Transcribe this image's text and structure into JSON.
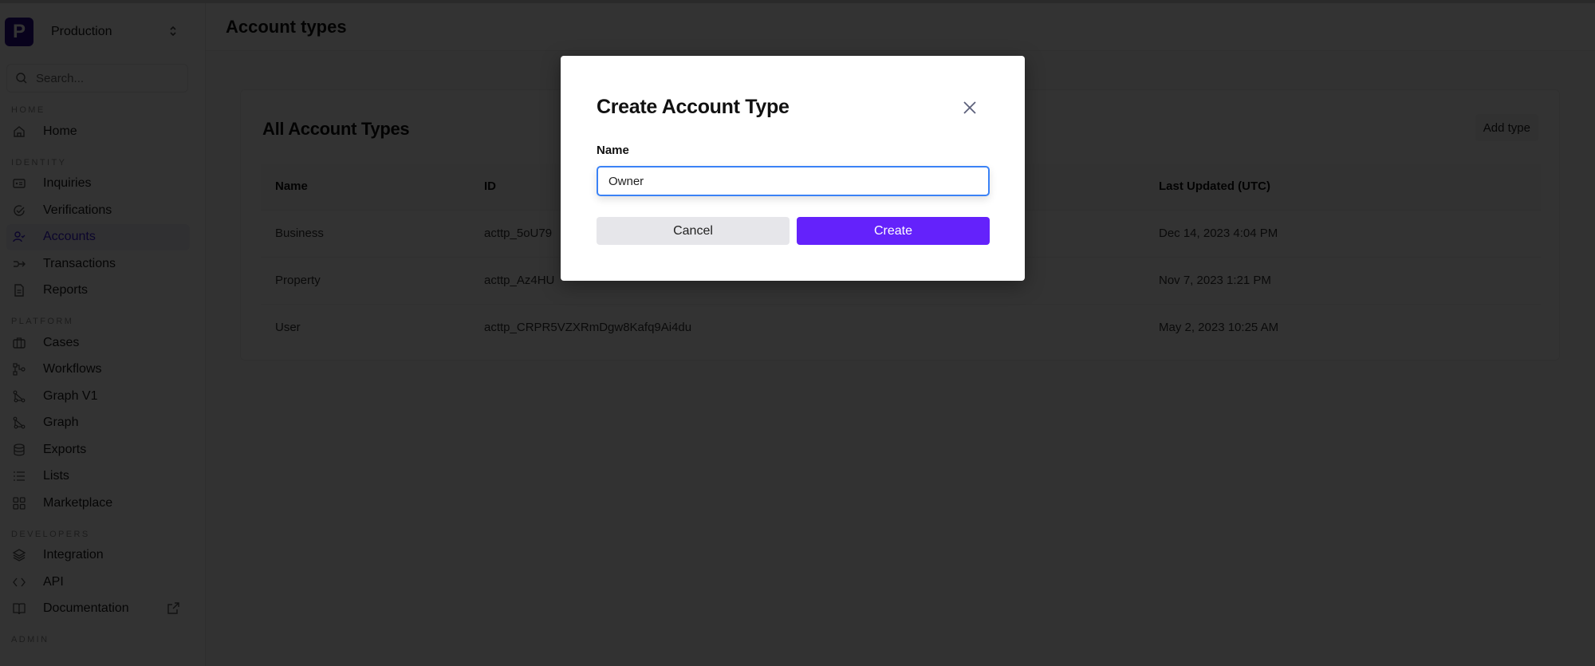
{
  "sidebar": {
    "org_initial": "P",
    "org_name": "Production",
    "search_placeholder": "Search...",
    "sections": [
      {
        "label": "HOME",
        "items": [
          {
            "label": "Home",
            "icon": "home-icon"
          }
        ]
      },
      {
        "label": "IDENTITY",
        "items": [
          {
            "label": "Inquiries",
            "icon": "id-card-icon"
          },
          {
            "label": "Verifications",
            "icon": "check-circle-icon"
          },
          {
            "label": "Accounts",
            "icon": "user-check-icon",
            "active": true
          },
          {
            "label": "Transactions",
            "icon": "arrow-flow-icon"
          },
          {
            "label": "Reports",
            "icon": "document-icon"
          }
        ]
      },
      {
        "label": "PLATFORM",
        "items": [
          {
            "label": "Cases",
            "icon": "briefcase-icon"
          },
          {
            "label": "Workflows",
            "icon": "workflow-icon"
          },
          {
            "label": "Graph V1",
            "icon": "graph-icon"
          },
          {
            "label": "Graph",
            "icon": "graph-icon"
          },
          {
            "label": "Exports",
            "icon": "database-icon"
          },
          {
            "label": "Lists",
            "icon": "list-icon"
          },
          {
            "label": "Marketplace",
            "icon": "grid-icon"
          }
        ]
      },
      {
        "label": "DEVELOPERS",
        "items": [
          {
            "label": "Integration",
            "icon": "layers-icon"
          },
          {
            "label": "API",
            "icon": "code-icon"
          },
          {
            "label": "Documentation",
            "icon": "book-icon",
            "external": true
          }
        ]
      },
      {
        "label": "ADMIN",
        "items": []
      }
    ]
  },
  "header": {
    "title": "Account types"
  },
  "card": {
    "title": "All Account Types",
    "add_button": "Add type",
    "columns": [
      "Name",
      "ID",
      "",
      "Last Updated (UTC)"
    ],
    "rows": [
      {
        "name": "Business",
        "id": "acttp_5oU79",
        "updated": "Dec 14, 2023 4:04 PM"
      },
      {
        "name": "Property",
        "id": "acttp_Az4HU",
        "updated": "Nov 7, 2023 1:21 PM"
      },
      {
        "name": "User",
        "id": "acttp_CRPR5VZXRmDgw8Kafq9Ai4du",
        "updated": "May 2, 2023 10:25 AM"
      }
    ]
  },
  "modal": {
    "title": "Create Account Type",
    "field_label": "Name",
    "input_value": "Owner",
    "cancel_label": "Cancel",
    "create_label": "Create"
  },
  "colors": {
    "accent": "#6422fb",
    "active_nav": "#3b1ad9",
    "logo_bg": "#2a0a8c",
    "focus_ring": "#3b82f6"
  }
}
